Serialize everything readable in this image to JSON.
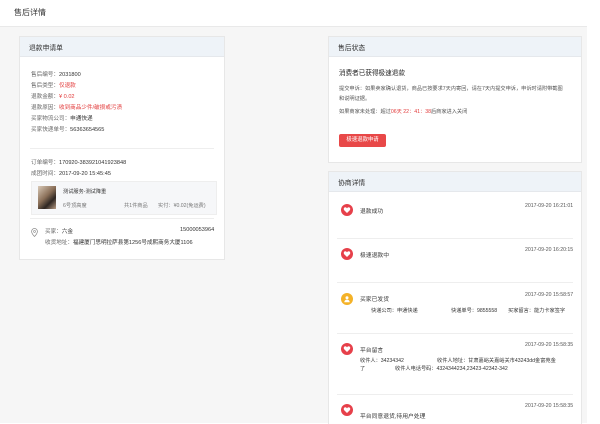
{
  "page": {
    "title": "售后详情"
  },
  "left": {
    "header": "退款申请单",
    "fields": [
      {
        "label": "售后编号：",
        "value": "2031800",
        "red": false
      },
      {
        "label": "售后类型：",
        "value": "仅退款",
        "red": true
      },
      {
        "label": "退款金额：",
        "value": "¥ 0.02",
        "red": true
      },
      {
        "label": "退款原因：",
        "value": "收到商品少件/破损或污渍",
        "red": true
      },
      {
        "label": "买家物流公司：",
        "value": "申通快递",
        "red": false
      },
      {
        "label": "买家快递单号：",
        "value": "56363654565",
        "red": false
      }
    ],
    "order_no_label": "订单编号：",
    "order_no": "170920-383921041923848",
    "deal_time_label": "成团时间：",
    "deal_time": "2017-09-20  15:45:45",
    "product": {
      "name": "测试服务-测试降重",
      "sub": "6号顶高度",
      "count": "共1件商品",
      "paid": "实付：¥0.02(免运费)"
    },
    "buyer_label": "买家：",
    "buyer_name": "六金",
    "buyer_phone": "15000053964",
    "address_label": "收货地址：",
    "address": "福建厦门思明拉萨县第1256号成熙商务大厦1106"
  },
  "right": {
    "status_header": "售后状态",
    "status_title": "消费者已获得极速退款",
    "status_desc_1": "提交申诉：如果卖家确认退货，商品已按要求7天内寄回，请在7天内提交申诉，申诉时请附带截图",
    "status_desc_2": "和说明证据。",
    "status_countdown_prefix": "如果商家未处理：超过",
    "status_countdown": "06天 22：41：38",
    "status_countdown_suffix": "后商家进入关闭",
    "status_button": "极速退款申请",
    "flow_header": "协商详情",
    "timeline": [
      {
        "title": "退款成功",
        "time": "2017-09-20  16:21:01",
        "icon": "heart-icon",
        "color": "#e6404a"
      },
      {
        "title": "极速退款中",
        "time": "2017-09-20  16:20:15",
        "icon": "heart-icon",
        "color": "#e6404a"
      },
      {
        "title": "买家已发货",
        "time": "2017-09-20  15:58:57",
        "icon": "person-icon",
        "color": "#f4b228",
        "detail": {
          "company_label": "快递公司：",
          "company": "申通快递",
          "no_label": "快递单号：",
          "no": "9855558",
          "remark_label": "买家留言：",
          "remark": "能力卡家签字"
        }
      },
      {
        "title": "平台留言",
        "time": "2017-09-20  15:58:35",
        "icon": "heart-icon",
        "color": "#e6404a",
        "detail": {
          "receiver_label": "收件人：",
          "receiver": "34234342",
          "addr_label": "收件人地址：",
          "addr": "甘肃嘉峪关嘉峪关市43243dd金富苑金",
          "addr2": "了",
          "phone_label": "收件人电话号码：",
          "phone": "4324344234,23423-42342-342"
        }
      },
      {
        "title": "平台同意退货,待用户处理",
        "time": "2017-09-20  15:58:35",
        "icon": "heart-icon",
        "color": "#e6404a"
      }
    ]
  }
}
